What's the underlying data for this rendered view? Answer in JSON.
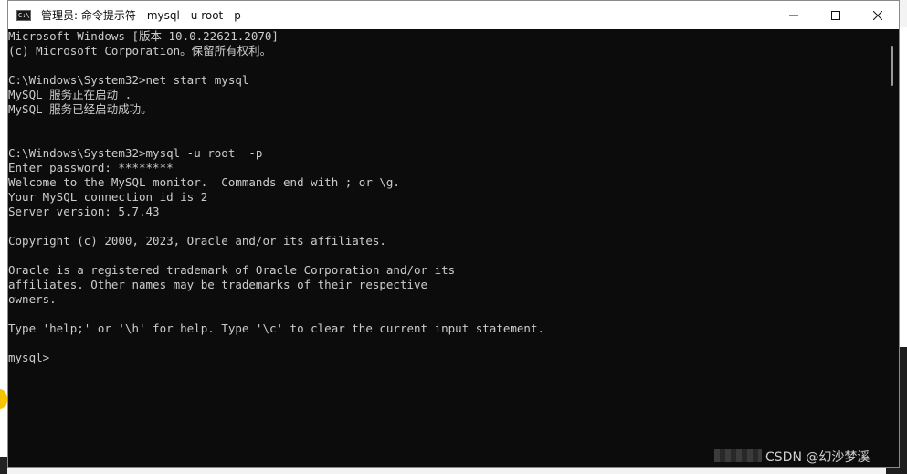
{
  "window": {
    "title": "管理员: 命令提示符 - mysql  -u root  -p",
    "icon": "cmd-icon",
    "controls": [
      "minimize-icon",
      "maximize-icon",
      "close-icon"
    ]
  },
  "console": {
    "lines": [
      "Microsoft Windows [版本 10.0.22621.2070]",
      "(c) Microsoft Corporation。保留所有权利。",
      "",
      "C:\\Windows\\System32>net start mysql",
      "MySQL 服务正在启动 .",
      "MySQL 服务已经启动成功。",
      "",
      "",
      "C:\\Windows\\System32>mysql -u root  -p",
      "Enter password: ********",
      "Welcome to the MySQL monitor.  Commands end with ; or \\g.",
      "Your MySQL connection id is 2",
      "Server version: 5.7.43",
      "",
      "Copyright (c) 2000, 2023, Oracle and/or its affiliates.",
      "",
      "Oracle is a registered trademark of Oracle Corporation and/or its",
      "affiliates. Other names may be trademarks of their respective",
      "owners.",
      "",
      "Type 'help;' or '\\h' for help. Type '\\c' to clear the current input statement.",
      "",
      "mysql>"
    ]
  },
  "watermark": "CSDN @幻沙梦溪",
  "colors": {
    "console_bg": "#0c0c0c",
    "console_text": "#cccccc",
    "titlebar_bg": "#ffffff"
  }
}
